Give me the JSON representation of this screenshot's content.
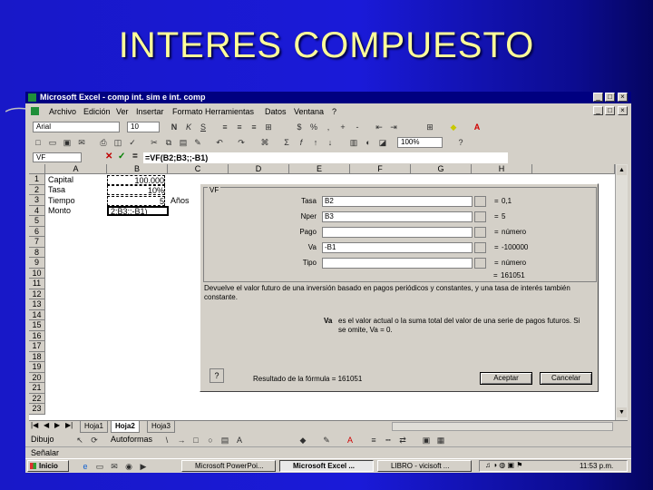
{
  "slide": {
    "title": "INTERES COMPUESTO"
  },
  "window": {
    "title": "Microsoft Excel - comp int. sim e int. comp",
    "menu": [
      "Archivo",
      "Edición",
      "Ver",
      "Insertar",
      "Formato",
      "Herramientas",
      "Datos",
      "Ventana",
      "?"
    ]
  },
  "toolbar": {
    "font": "Arial",
    "size": "10",
    "zoom": "100%"
  },
  "formula_bar": {
    "name_box": "VF",
    "formula": "=VF(B2;B3;;-B1)"
  },
  "columns": [
    "A",
    "B",
    "C",
    "D",
    "E",
    "F",
    "G",
    "H"
  ],
  "rows": [
    "1",
    "2",
    "3",
    "4",
    "5",
    "6",
    "7",
    "8",
    "9",
    "10",
    "11",
    "12",
    "13",
    "14",
    "15",
    "16",
    "17",
    "18",
    "19",
    "20",
    "21",
    "22",
    "23"
  ],
  "cells": {
    "a1": "Capital",
    "b1": "100.000",
    "a2": "Tasa",
    "b2": "10%",
    "a3": "Tiempo",
    "b3": "5",
    "c3": "Años",
    "a4": "Monto",
    "b4": "2;B3;;-B1)"
  },
  "sheet_tabs": [
    "Hoja1",
    "Hoja2",
    "Hoja3"
  ],
  "drawing": {
    "draw_label": "Dibujo",
    "autoshapes_label": "Autoformas"
  },
  "status": "Señalar",
  "taskbar": {
    "start": "Inicio",
    "tasks": [
      "Microsoft PowerPoi...",
      "Microsoft Excel ...",
      "LIBRO - vicisoft ..."
    ],
    "clock": "11:53 p.m."
  },
  "dialog": {
    "function": "VF",
    "args": [
      {
        "label": "Tasa",
        "value": "B2",
        "result": "0,1"
      },
      {
        "label": "Nper",
        "value": "B3",
        "result": "5"
      },
      {
        "label": "Pago",
        "value": "",
        "result": "número"
      },
      {
        "label": "Va",
        "value": "-B1",
        "result": "-100000"
      },
      {
        "label": "Tipo",
        "value": "",
        "result": "número"
      }
    ],
    "total_result": "161051",
    "description": "Devuelve el valor futuro de una inversión basado en pagos periódicos y constantes, y una tasa de interés también constante.",
    "arg_help_name": "Va",
    "arg_help": "es el valor actual o la suma total del valor de una serie de pagos futuros. Si se omite, Va = 0.",
    "formula_result": "Resultado de la fórmula = 161051",
    "ok": "Aceptar",
    "cancel": "Cancelar"
  }
}
